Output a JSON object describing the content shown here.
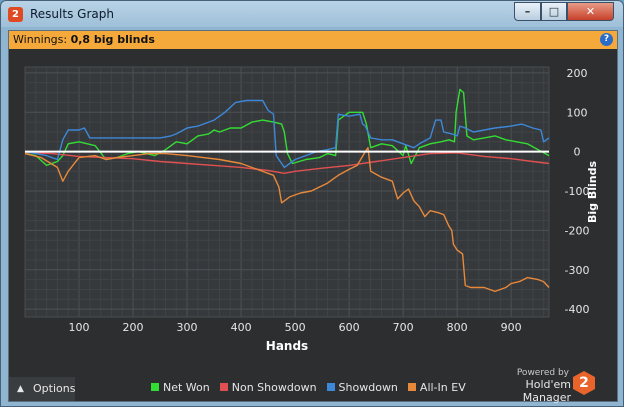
{
  "window": {
    "title": "Results Graph",
    "app_icon_text": "2",
    "buttons": {
      "minimize": "–",
      "maximize": "□",
      "close": "✕"
    }
  },
  "winnings": {
    "label": "Winnings:",
    "value": "0,8 big blinds"
  },
  "help_icon": "?",
  "options_label": "Options",
  "powered": {
    "line1": "Powered by",
    "line2": "Hold'em Manager",
    "logo_text": "2"
  },
  "chart_data": {
    "type": "line",
    "xlabel": "Hands",
    "ylabel": "Big Blinds",
    "x_ticks": [
      100,
      200,
      300,
      400,
      500,
      600,
      700,
      800,
      900
    ],
    "y_ticks": [
      200,
      100,
      0,
      -100,
      -200,
      -300,
      -400
    ],
    "xlim": [
      0,
      970
    ],
    "ylim": [
      -420,
      215
    ],
    "grid": true,
    "legend_position": "bottom",
    "series": [
      {
        "name": "Net Won",
        "color": "#33dd33",
        "points": [
          [
            0,
            -5
          ],
          [
            20,
            -10
          ],
          [
            40,
            -35
          ],
          [
            60,
            -25
          ],
          [
            70,
            -10
          ],
          [
            80,
            20
          ],
          [
            100,
            25
          ],
          [
            130,
            15
          ],
          [
            150,
            -20
          ],
          [
            170,
            -15
          ],
          [
            190,
            -5
          ],
          [
            210,
            0
          ],
          [
            240,
            -10
          ],
          [
            260,
            5
          ],
          [
            280,
            25
          ],
          [
            300,
            20
          ],
          [
            320,
            40
          ],
          [
            340,
            45
          ],
          [
            350,
            55
          ],
          [
            360,
            50
          ],
          [
            380,
            60
          ],
          [
            400,
            60
          ],
          [
            420,
            75
          ],
          [
            440,
            80
          ],
          [
            460,
            75
          ],
          [
            475,
            70
          ],
          [
            480,
            50
          ],
          [
            486,
            -5
          ],
          [
            495,
            -30
          ],
          [
            520,
            -20
          ],
          [
            545,
            -15
          ],
          [
            560,
            -5
          ],
          [
            575,
            -10
          ],
          [
            580,
            80
          ],
          [
            600,
            100
          ],
          [
            625,
            100
          ],
          [
            632,
            70
          ],
          [
            640,
            10
          ],
          [
            660,
            20
          ],
          [
            680,
            15
          ],
          [
            700,
            -10
          ],
          [
            705,
            15
          ],
          [
            715,
            -30
          ],
          [
            730,
            10
          ],
          [
            750,
            20
          ],
          [
            770,
            25
          ],
          [
            785,
            30
          ],
          [
            795,
            25
          ],
          [
            798,
            100
          ],
          [
            805,
            158
          ],
          [
            812,
            150
          ],
          [
            818,
            40
          ],
          [
            830,
            30
          ],
          [
            850,
            35
          ],
          [
            870,
            40
          ],
          [
            890,
            30
          ],
          [
            910,
            25
          ],
          [
            930,
            20
          ],
          [
            950,
            5
          ],
          [
            970,
            -10
          ]
        ]
      },
      {
        "name": "Non Showdown",
        "color": "#e05050",
        "points": [
          [
            0,
            -2
          ],
          [
            50,
            -5
          ],
          [
            100,
            -12
          ],
          [
            150,
            -15
          ],
          [
            200,
            -18
          ],
          [
            250,
            -25
          ],
          [
            300,
            -30
          ],
          [
            350,
            -35
          ],
          [
            400,
            -40
          ],
          [
            450,
            -48
          ],
          [
            480,
            -55
          ],
          [
            500,
            -50
          ],
          [
            550,
            -42
          ],
          [
            600,
            -35
          ],
          [
            650,
            -25
          ],
          [
            700,
            -15
          ],
          [
            750,
            -5
          ],
          [
            800,
            -3
          ],
          [
            850,
            -12
          ],
          [
            900,
            -18
          ],
          [
            940,
            -25
          ],
          [
            970,
            -30
          ]
        ]
      },
      {
        "name": "Showdown",
        "color": "#3d88d8",
        "points": [
          [
            0,
            0
          ],
          [
            40,
            -10
          ],
          [
            60,
            -20
          ],
          [
            70,
            30
          ],
          [
            80,
            55
          ],
          [
            100,
            55
          ],
          [
            110,
            60
          ],
          [
            120,
            35
          ],
          [
            150,
            35
          ],
          [
            250,
            35
          ],
          [
            270,
            40
          ],
          [
            280,
            45
          ],
          [
            300,
            60
          ],
          [
            320,
            65
          ],
          [
            350,
            80
          ],
          [
            370,
            100
          ],
          [
            390,
            125
          ],
          [
            410,
            130
          ],
          [
            440,
            130
          ],
          [
            450,
            105
          ],
          [
            460,
            95
          ],
          [
            465,
            -10
          ],
          [
            480,
            -40
          ],
          [
            500,
            -20
          ],
          [
            540,
            0
          ],
          [
            560,
            5
          ],
          [
            575,
            10
          ],
          [
            580,
            95
          ],
          [
            600,
            90
          ],
          [
            620,
            95
          ],
          [
            625,
            70
          ],
          [
            630,
            65
          ],
          [
            640,
            35
          ],
          [
            660,
            30
          ],
          [
            680,
            30
          ],
          [
            700,
            20
          ],
          [
            720,
            10
          ],
          [
            730,
            20
          ],
          [
            750,
            35
          ],
          [
            760,
            80
          ],
          [
            770,
            80
          ],
          [
            775,
            50
          ],
          [
            790,
            45
          ],
          [
            800,
            40
          ],
          [
            805,
            65
          ],
          [
            815,
            60
          ],
          [
            830,
            50
          ],
          [
            850,
            55
          ],
          [
            870,
            60
          ],
          [
            900,
            65
          ],
          [
            920,
            70
          ],
          [
            940,
            60
          ],
          [
            955,
            55
          ],
          [
            960,
            25
          ],
          [
            970,
            35
          ]
        ]
      },
      {
        "name": "All-In EV",
        "color": "#e8893a",
        "points": [
          [
            0,
            -5
          ],
          [
            30,
            -15
          ],
          [
            60,
            -40
          ],
          [
            70,
            -75
          ],
          [
            80,
            -50
          ],
          [
            100,
            -15
          ],
          [
            130,
            -10
          ],
          [
            150,
            -20
          ],
          [
            170,
            -15
          ],
          [
            200,
            -10
          ],
          [
            230,
            -5
          ],
          [
            260,
            -5
          ],
          [
            300,
            -10
          ],
          [
            330,
            -15
          ],
          [
            360,
            -20
          ],
          [
            380,
            -25
          ],
          [
            400,
            -30
          ],
          [
            430,
            -45
          ],
          [
            460,
            -60
          ],
          [
            470,
            -90
          ],
          [
            475,
            -130
          ],
          [
            490,
            -115
          ],
          [
            510,
            -105
          ],
          [
            530,
            -100
          ],
          [
            560,
            -80
          ],
          [
            580,
            -60
          ],
          [
            600,
            -45
          ],
          [
            615,
            -35
          ],
          [
            630,
            0
          ],
          [
            635,
            10
          ],
          [
            640,
            -50
          ],
          [
            660,
            -65
          ],
          [
            680,
            -75
          ],
          [
            690,
            -120
          ],
          [
            700,
            -105
          ],
          [
            710,
            -95
          ],
          [
            720,
            -125
          ],
          [
            730,
            -140
          ],
          [
            740,
            -165
          ],
          [
            750,
            -150
          ],
          [
            765,
            -155
          ],
          [
            775,
            -160
          ],
          [
            785,
            -190
          ],
          [
            790,
            -200
          ],
          [
            793,
            -235
          ],
          [
            800,
            -250
          ],
          [
            810,
            -260
          ],
          [
            815,
            -340
          ],
          [
            825,
            -345
          ],
          [
            850,
            -345
          ],
          [
            870,
            -355
          ],
          [
            890,
            -345
          ],
          [
            900,
            -335
          ],
          [
            915,
            -330
          ],
          [
            930,
            -320
          ],
          [
            950,
            -325
          ],
          [
            960,
            -330
          ],
          [
            970,
            -345
          ]
        ]
      }
    ]
  }
}
